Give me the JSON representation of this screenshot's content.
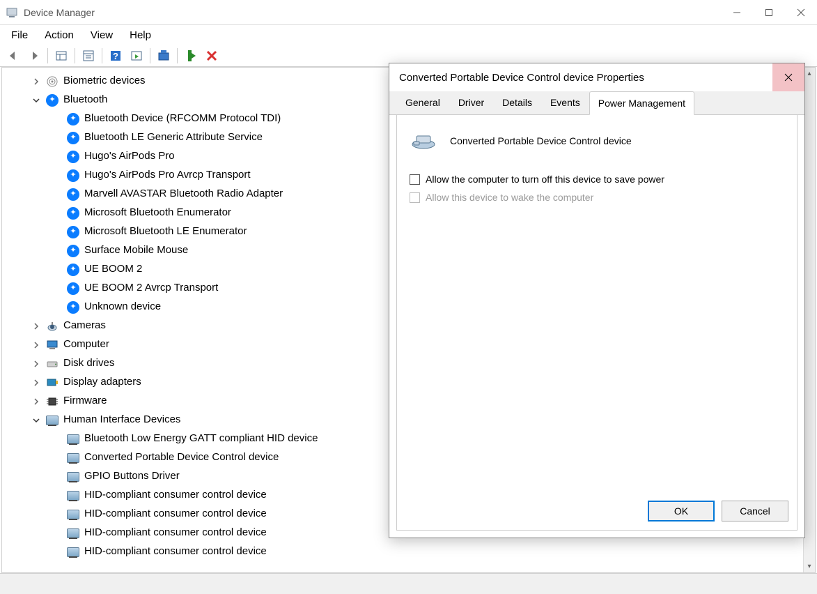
{
  "window": {
    "title": "Device Manager"
  },
  "menu": {
    "file": "File",
    "action": "Action",
    "view": "View",
    "help": "Help"
  },
  "tree": {
    "biometric": "Biometric devices",
    "bluetooth": "Bluetooth",
    "bt_items": [
      "Bluetooth Device (RFCOMM Protocol TDI)",
      "Bluetooth LE Generic Attribute Service",
      "Hugo's AirPods Pro",
      "Hugo's AirPods Pro Avrcp Transport",
      "Marvell AVASTAR Bluetooth Radio Adapter",
      "Microsoft Bluetooth Enumerator",
      "Microsoft Bluetooth LE Enumerator",
      "Surface Mobile Mouse",
      "UE BOOM 2",
      "UE BOOM 2 Avrcp Transport",
      "Unknown device"
    ],
    "cameras": "Cameras",
    "computer": "Computer",
    "disk": "Disk drives",
    "display": "Display adapters",
    "firmware": "Firmware",
    "hid": "Human Interface Devices",
    "hid_items": [
      "Bluetooth Low Energy GATT compliant HID device",
      "Converted Portable Device Control device",
      "GPIO Buttons Driver",
      "HID-compliant consumer control device",
      "HID-compliant consumer control device",
      "HID-compliant consumer control device",
      "HID-compliant consumer control device"
    ]
  },
  "dialog": {
    "title": "Converted Portable Device Control device Properties",
    "tabs": {
      "general": "General",
      "driver": "Driver",
      "details": "Details",
      "events": "Events",
      "power": "Power Management"
    },
    "device_name": "Converted Portable Device Control device",
    "chk_turnoff": "Allow the computer to turn off this device to save power",
    "chk_wake": "Allow this device to wake the computer",
    "ok": "OK",
    "cancel": "Cancel"
  }
}
